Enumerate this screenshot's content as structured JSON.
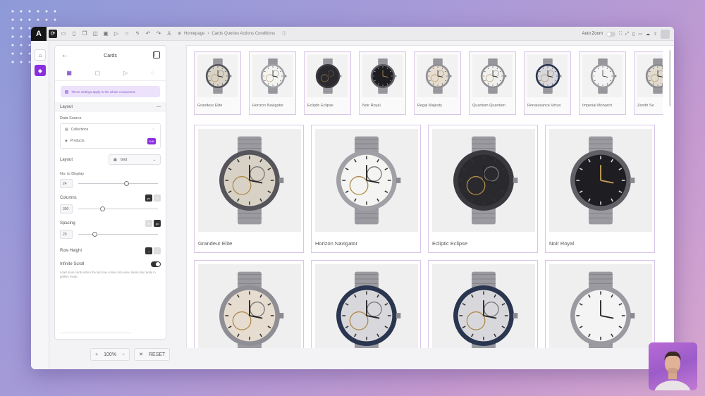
{
  "toolbar": {
    "logo": "A",
    "breadcrumb": [
      "Homepage",
      "Cards Queries Actions Conditions"
    ],
    "auto_zoom_label": "Auto Zoom"
  },
  "panel": {
    "title": "Cards",
    "note": "These settings apply to the whole component.",
    "layout_section": "Layout",
    "data_source_label": "Data Source",
    "data_source_type": "Collections",
    "data_source_value": "Products",
    "data_source_badge": "Edit",
    "layout_label": "Layout",
    "layout_value": "Grid",
    "no_display_label": "No. to Display",
    "no_display_value": "24",
    "no_display_level": 0.6,
    "columns_label": "Columns",
    "columns_value": "300",
    "columns_level": 0.3,
    "spacing_label": "Spacing",
    "spacing_value": "20",
    "spacing_level": 0.2,
    "unit_px": "px",
    "unit_pct": "%",
    "row_height_label": "Row Height",
    "infinite_scroll_label": "Infinite Scroll",
    "infinite_scroll_desc": "Load more cards when the last row comes into view. Ideal only rarely in gallery mode."
  },
  "zoom": {
    "plus": "+",
    "value": "100%",
    "minus": "−",
    "reset": "RESET"
  },
  "products_strip": [
    "Grandeur Elite",
    "Horizon Navigator",
    "Ecliptic Eclipse",
    "Noir Royal",
    "Regal Majesty",
    "Quantum Quantum",
    "Renaissance Virtuo",
    "Imperial Monarch",
    "Zenith Se"
  ],
  "products_grid": [
    "Grandeur Elite",
    "Horizon Navigator",
    "Ecliptic Eclipse",
    "Noir Royal",
    "",
    "",
    "",
    ""
  ],
  "icons": [
    "back-arrow-icon",
    "dock-icon",
    "grid-icon",
    "home-icon",
    "page-icon",
    "undo-icon",
    "redo-icon",
    "globe-icon",
    "help-icon",
    "watch-icon"
  ],
  "colors": {
    "accent": "#8a2ee0",
    "card_border": "#d8c6e8"
  }
}
